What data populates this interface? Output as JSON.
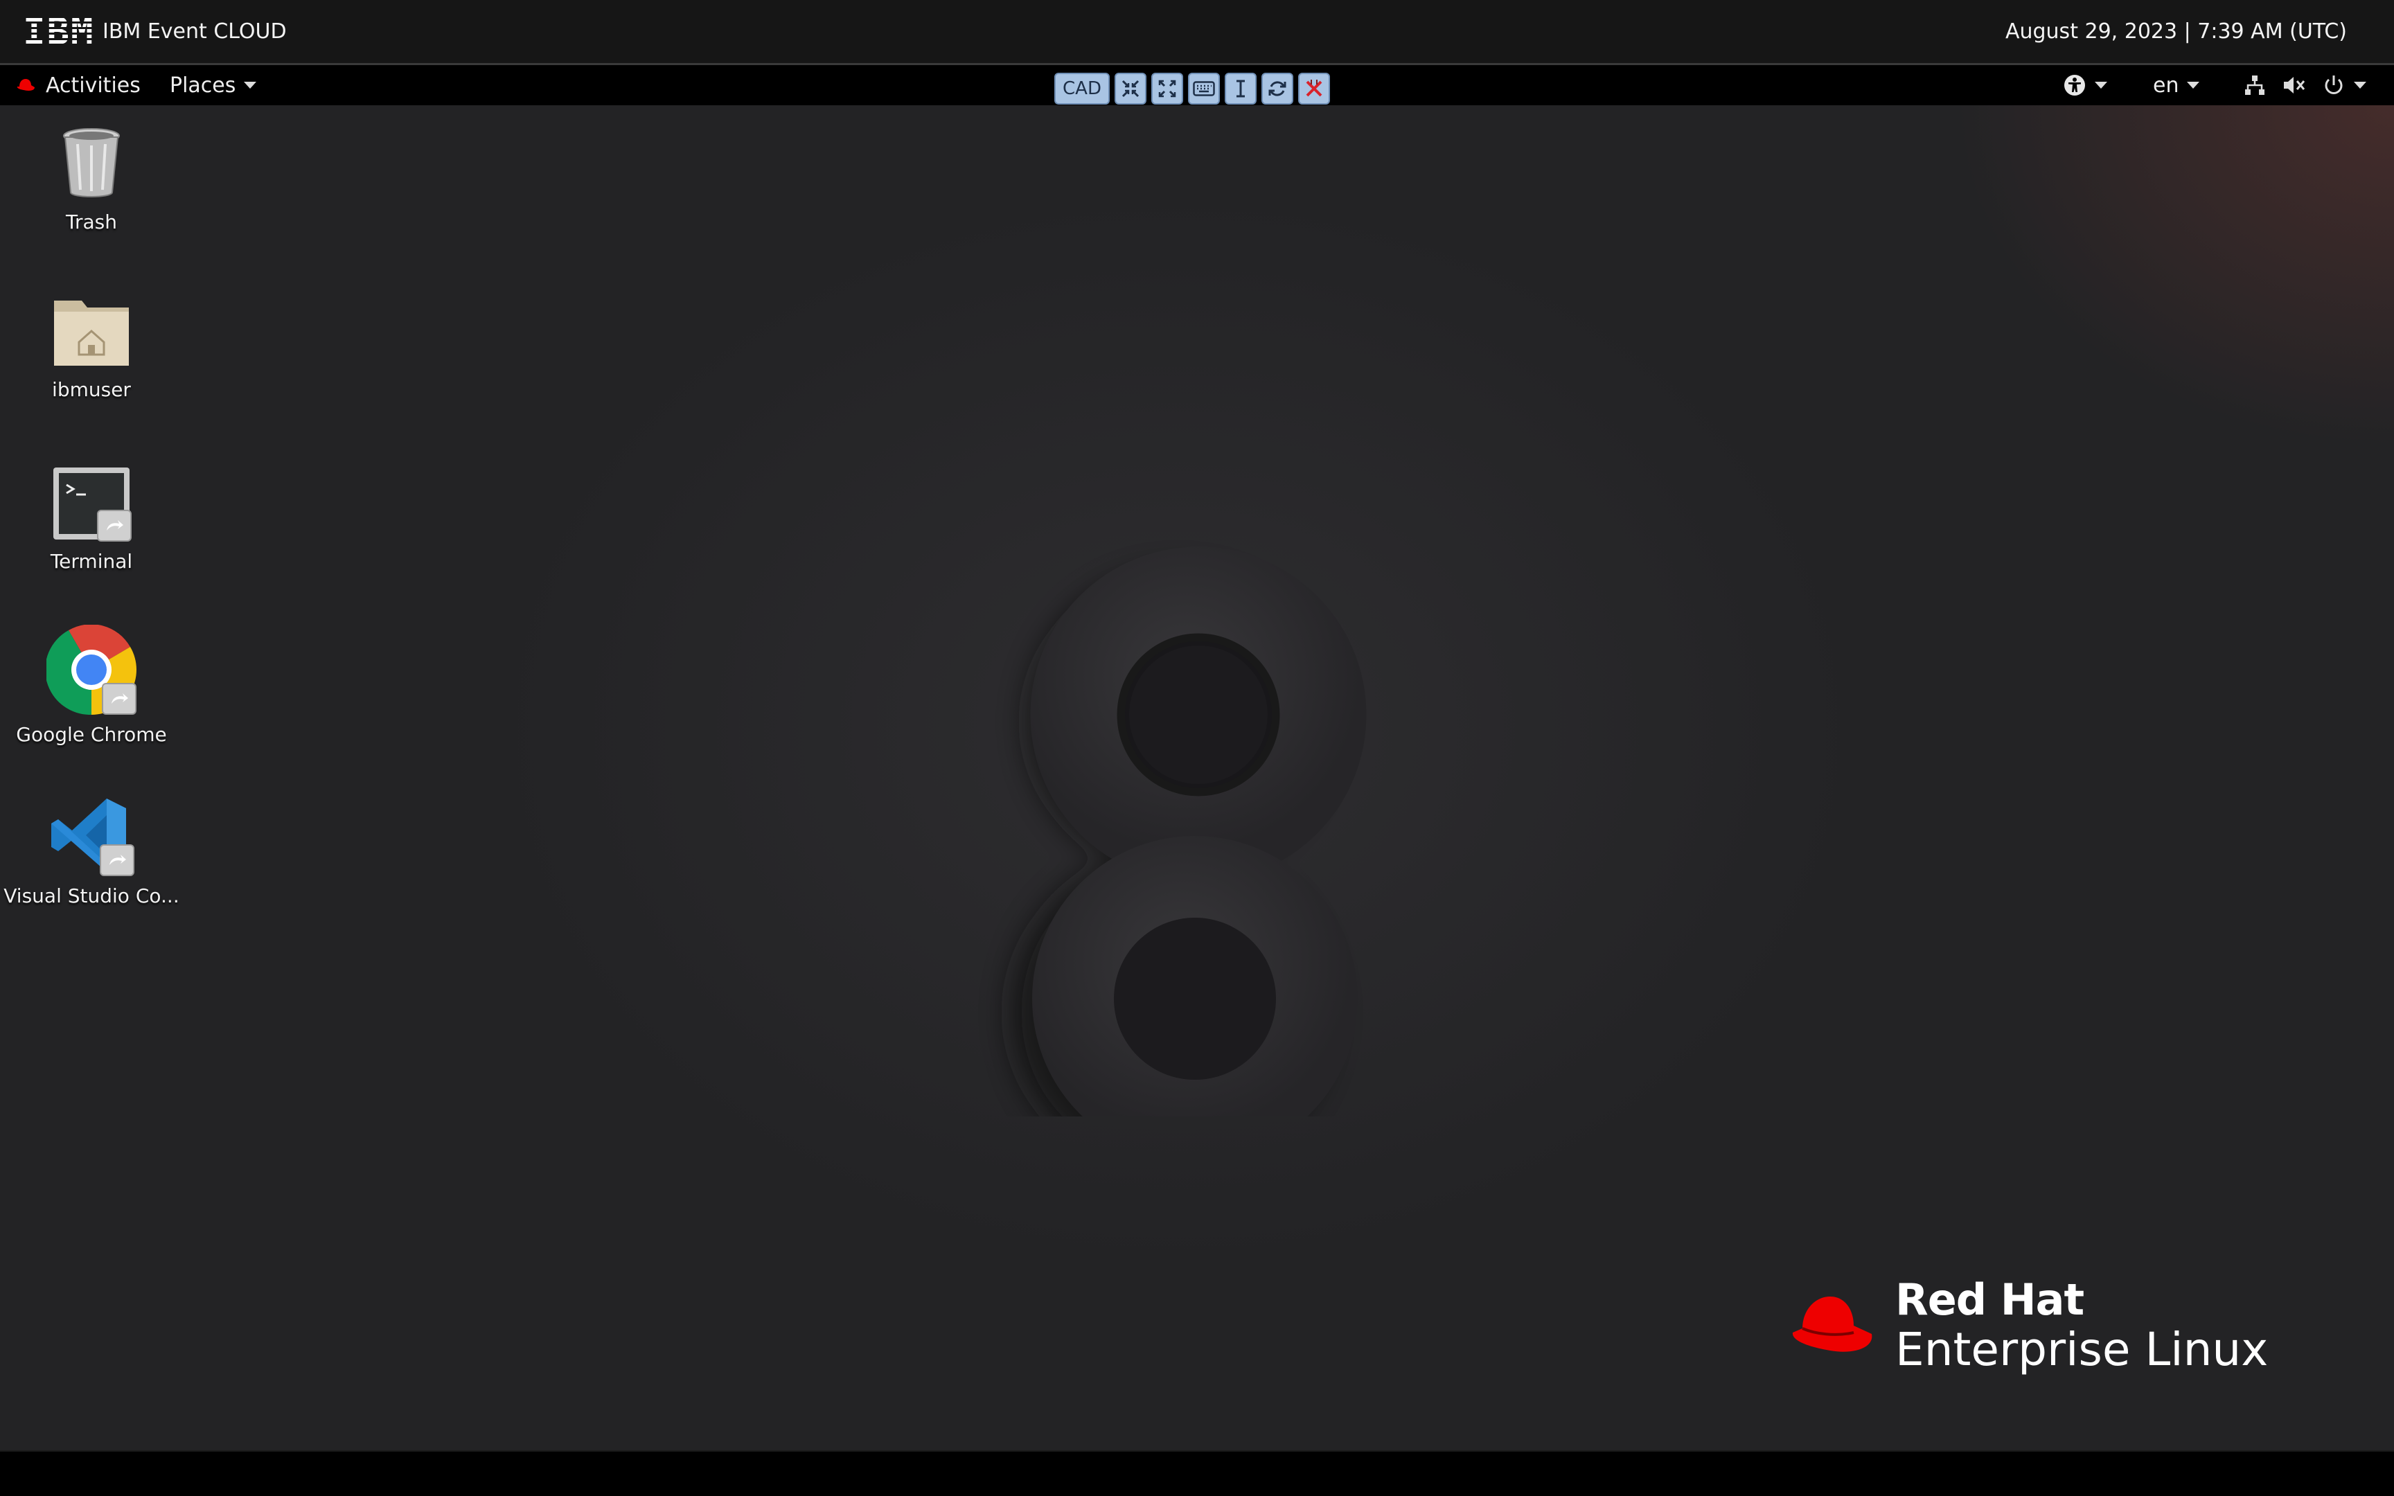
{
  "header": {
    "logo_text": "IBM",
    "title": "IBM Event CLOUD",
    "datetime": "August 29, 2023 | 7:39 AM (UTC)"
  },
  "topbar": {
    "activities_label": "Activities",
    "places_label": "Places",
    "language": "en"
  },
  "toolbar": {
    "cad_label": "CAD",
    "buttons": [
      "shrink-icon",
      "fullscreen-icon",
      "keyboard-icon",
      "text-cursor-icon",
      "refresh-icon",
      "disconnect-icon"
    ]
  },
  "desktop_icons": [
    {
      "label": "Trash",
      "icon": "trash-icon"
    },
    {
      "label": "ibmuser",
      "icon": "home-folder-icon"
    },
    {
      "label": "Terminal",
      "icon": "terminal-icon"
    },
    {
      "label": "Google Chrome",
      "icon": "chrome-icon"
    },
    {
      "label": "Visual Studio Co...",
      "icon": "vscode-icon"
    }
  ],
  "wallpaper": {
    "numeral": "8",
    "brand_name": "Red Hat",
    "brand_product": "Enterprise Linux"
  },
  "colors": {
    "brand_red": "#ee0000",
    "desktop_bg": "#262628",
    "toolbar_button": "#a9c4e3"
  }
}
